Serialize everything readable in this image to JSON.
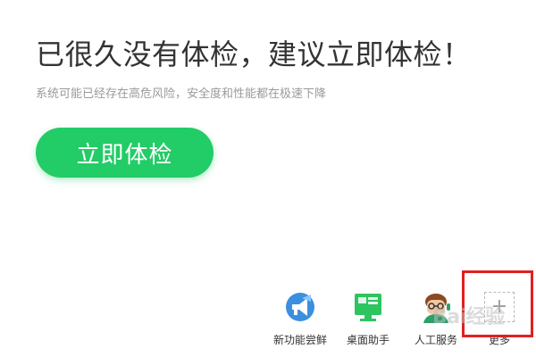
{
  "main": {
    "headline": "已很久没有体检，建议立即体检！",
    "subtext": "系统可能已经存在高危风险，安全度和性能都在极速下降",
    "check_button_label": "立即体检"
  },
  "tools": {
    "items": [
      {
        "label": "新功能尝鲜",
        "icon": "megaphone-icon"
      },
      {
        "label": "桌面助手",
        "icon": "monitor-icon"
      },
      {
        "label": "人工服务",
        "icon": "avatar-icon"
      },
      {
        "label": "更多",
        "icon": "plus-icon"
      }
    ]
  },
  "overlay": {
    "watermark": "Bai经验",
    "highlight_color": "#e02020"
  },
  "colors": {
    "accent": "#22cc66",
    "headline": "#333333",
    "subtext": "#9a9a9a"
  }
}
